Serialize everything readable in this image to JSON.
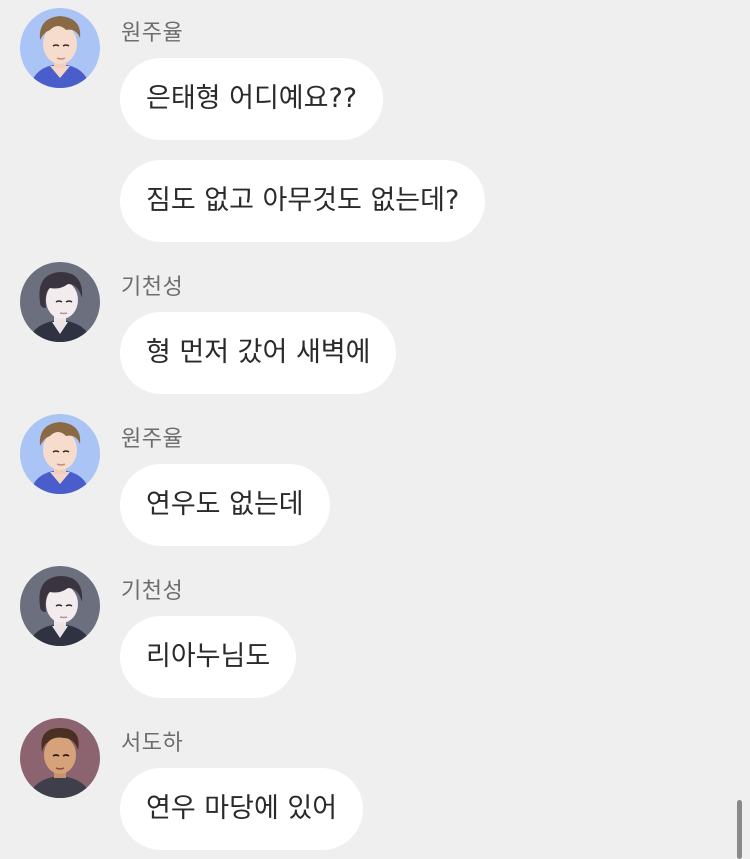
{
  "messages": [
    {
      "sender": "원주율",
      "avatar_icon": "wonjuyul-avatar-icon",
      "bubbles": [
        "은태형 어디예요??",
        "짐도 없고 아무것도 없는데?"
      ]
    },
    {
      "sender": "기천성",
      "avatar_icon": "gicheonseong-avatar-icon",
      "bubbles": [
        "형 먼저 갔어 새벽에"
      ]
    },
    {
      "sender": "원주율",
      "avatar_icon": "wonjuyul-avatar-icon",
      "bubbles": [
        "연우도 없는데"
      ]
    },
    {
      "sender": "기천성",
      "avatar_icon": "gicheonseong-avatar-icon",
      "bubbles": [
        "리아누님도"
      ]
    },
    {
      "sender": "서도하",
      "avatar_icon": "seodoha-avatar-icon",
      "bubbles": [
        "연우 마당에 있어"
      ]
    }
  ],
  "colors": {
    "background": "#efefef",
    "bubble": "#ffffff",
    "sender_name": "#6d6d6d",
    "message_text": "#2a2a2a"
  }
}
